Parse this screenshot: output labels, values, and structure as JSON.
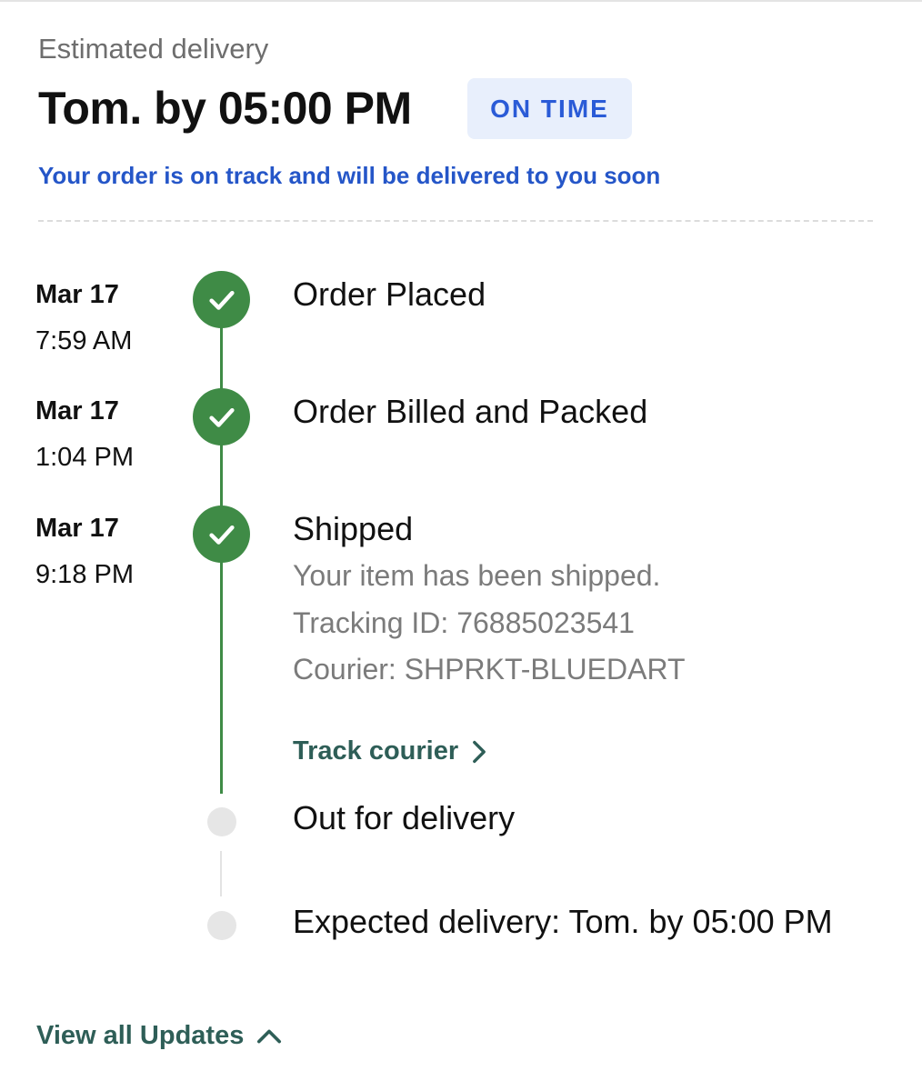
{
  "header": {
    "estimated_label": "Estimated delivery",
    "estimated_value": "Tom. by 05:00 PM",
    "status_badge": "ON TIME",
    "status_message": "Your order is on track and will be delivered to you soon"
  },
  "timeline": {
    "steps": [
      {
        "date": "Mar 17",
        "time": "7:59 AM",
        "title": "Order Placed",
        "state": "done"
      },
      {
        "date": "Mar 17",
        "time": "1:04 PM",
        "title": "Order Billed and Packed",
        "state": "done"
      },
      {
        "date": "Mar 17",
        "time": "9:18 PM",
        "title": "Shipped",
        "state": "done",
        "details": [
          "Your item has been shipped.",
          "Tracking ID: 76885023541",
          "Courier: SHPRKT-BLUEDART"
        ],
        "link_label": "Track courier"
      },
      {
        "title": "Out for delivery",
        "state": "pending"
      },
      {
        "title": "Expected delivery: Tom. by 05:00 PM",
        "state": "pending"
      }
    ]
  },
  "footer": {
    "view_all_label": "View all Updates"
  },
  "colors": {
    "done": "#3f8b46",
    "pending": "#e6e6e6",
    "accent_blue": "#2556c8",
    "badge_bg": "#e8effc",
    "link": "#2e5e57"
  },
  "icons": {
    "done_step": "check-icon",
    "track_link": "chevron-right-icon",
    "view_all": "chevron-up-icon"
  }
}
